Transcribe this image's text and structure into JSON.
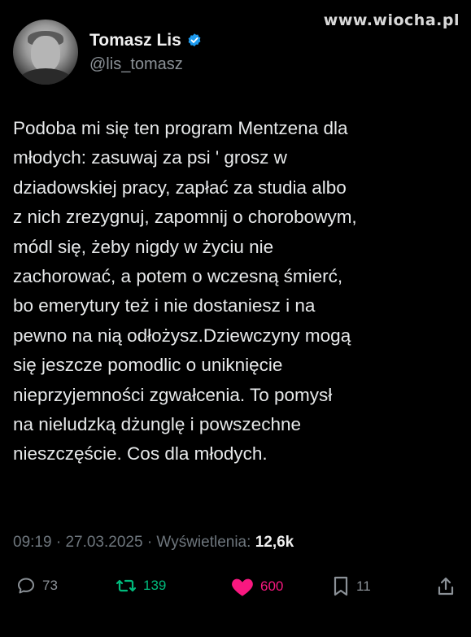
{
  "watermark": "www.wiocha.pl",
  "author": {
    "display_name": "Tomasz Lis",
    "handle": "@lis_tomasz",
    "verified": true,
    "verified_icon": "verified-badge-icon",
    "avatar_icon": "avatar"
  },
  "tweet": {
    "text": "Podoba mi się ten program Mentzena dla\nmłodych: zasuwaj za psi ' grosz w\ndziadowskiej pracy, zapłać za studia albo\nz nich zrezygnuj, zapomnij o chorobowym,\nmódl się, żeby nigdy w życiu nie\nzachorować, a potem o wczesną śmierć,\nbo emerytury też i nie dostaniesz i na\npewno na nią odłożysz.Dziewczyny mogą\nsię jeszcze pomodlic o uniknięcie\nnieprzyjemności zgwałcenia. To pomysł\nna nieludzką dżunglę i powszechne\nnieszczęście. Cos dla młodych."
  },
  "meta": {
    "time": "09:19",
    "date": "27.03.2025",
    "views_label": "Wyświetlenia:",
    "views_count": "12,6k",
    "separator": "·"
  },
  "actions": {
    "replies": "73",
    "retweets": "139",
    "likes": "600",
    "bookmarks": "11"
  },
  "colors": {
    "background": "#000000",
    "text": "#e7e9ea",
    "muted": "#6e767d",
    "verified": "#1d9bf0",
    "retweet": "#00ba7c",
    "like": "#f91880"
  }
}
